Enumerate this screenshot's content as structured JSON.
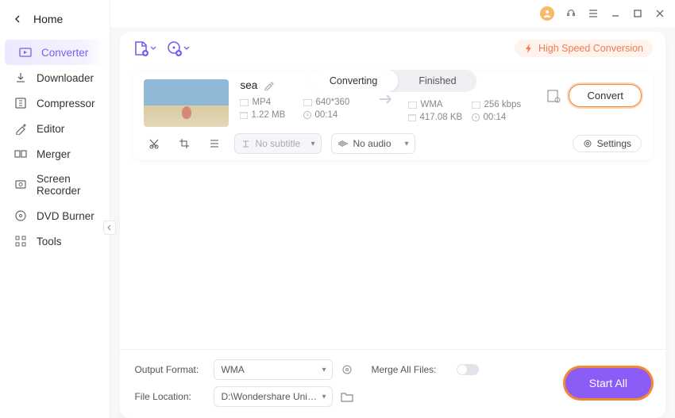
{
  "home_label": "Home",
  "sidebar": {
    "items": [
      {
        "label": "Converter"
      },
      {
        "label": "Downloader"
      },
      {
        "label": "Compressor"
      },
      {
        "label": "Editor"
      },
      {
        "label": "Merger"
      },
      {
        "label": "Screen Recorder"
      },
      {
        "label": "DVD Burner"
      },
      {
        "label": "Tools"
      }
    ]
  },
  "tabs": {
    "converting": "Converting",
    "finished": "Finished"
  },
  "hsc_label": "High Speed Conversion",
  "file": {
    "name": "sea",
    "src": {
      "format": "MP4",
      "res": "640*360",
      "size": "1.22 MB",
      "dur": "00:14"
    },
    "dst": {
      "format": "WMA",
      "bitrate": "256 kbps",
      "size": "417.08 KB",
      "dur": "00:14"
    },
    "subtitle": "No subtitle",
    "audio": "No audio",
    "convert_label": "Convert",
    "settings_label": "Settings"
  },
  "footer": {
    "output_format_label": "Output Format:",
    "output_format_value": "WMA",
    "file_location_label": "File Location:",
    "file_location_value": "D:\\Wondershare UniConverter 1",
    "merge_label": "Merge All Files:",
    "start_all": "Start All"
  }
}
